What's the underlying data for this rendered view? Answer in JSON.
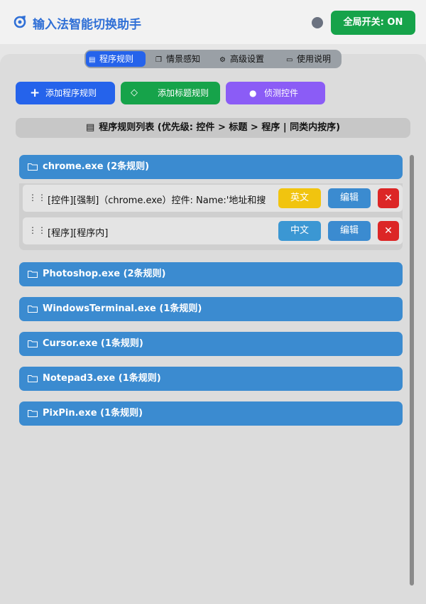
{
  "header": {
    "title": "输入法智能切换助手",
    "toggle_label": "全局开关: ON",
    "status": "gray"
  },
  "tabs": [
    {
      "label": "程序规则",
      "icon": "document-icon",
      "active": true
    },
    {
      "label": "情景感知",
      "icon": "windows-icon",
      "active": false
    },
    {
      "label": "高级设置",
      "icon": "gear-icon",
      "active": false
    },
    {
      "label": "使用说明",
      "icon": "book-icon",
      "active": false
    }
  ],
  "actions": {
    "add_program": "添加程序规则",
    "add_title": "添加标题规则",
    "detect_control": "侦测控件"
  },
  "list_header": "程序规则列表 (优先级: 控件 > 标题 > 程序 | 同类内按序)",
  "groups": [
    {
      "label": "chrome.exe (2条规则)"
    },
    {
      "label": "Photoshop.exe (2条规则)"
    },
    {
      "label": "WindowsTerminal.exe (1条规则)"
    },
    {
      "label": "Cursor.exe (1条规则)"
    },
    {
      "label": "Notepad3.exe (1条规则)"
    },
    {
      "label": "PixPin.exe (1条规则)"
    }
  ],
  "rules": [
    {
      "text": "[控件][强制]（chrome.exe）控件: Name:'地址和搜",
      "lang": "英文",
      "edit": "编辑",
      "delete": "✕"
    },
    {
      "text": "[程序][程序内]",
      "lang": "中文",
      "edit": "编辑",
      "delete": "✕"
    }
  ],
  "colors": {
    "primary": "#2563eb",
    "success": "#16a34a",
    "purple": "#8b5cf6",
    "group": "#3b8bd0",
    "english": "#f1c40f",
    "chinese": "#3b97d3",
    "danger": "#dc2626"
  }
}
